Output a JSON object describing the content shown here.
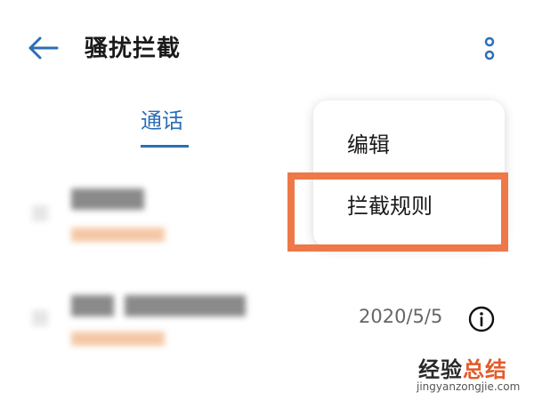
{
  "header": {
    "title": "骚扰拦截",
    "back_icon": "back-arrow-icon",
    "more_icon": "more-vertical-icon"
  },
  "tabs": [
    {
      "label": "通话",
      "selected": true
    }
  ],
  "list": {
    "items": [
      {
        "date": ""
      },
      {
        "date": "2020/5/5",
        "info_icon": "info-icon"
      }
    ]
  },
  "menu": {
    "items": [
      {
        "label": "编辑"
      },
      {
        "label": "拦截规则",
        "highlighted": true
      }
    ]
  },
  "watermark": {
    "cn_part1": "经验",
    "cn_part2": "总结",
    "en": "jingyanzongjie.com"
  },
  "colors": {
    "accent": "#2c6fb5",
    "highlight_border": "#ee7848",
    "watermark_accent": "#e45a2a"
  }
}
